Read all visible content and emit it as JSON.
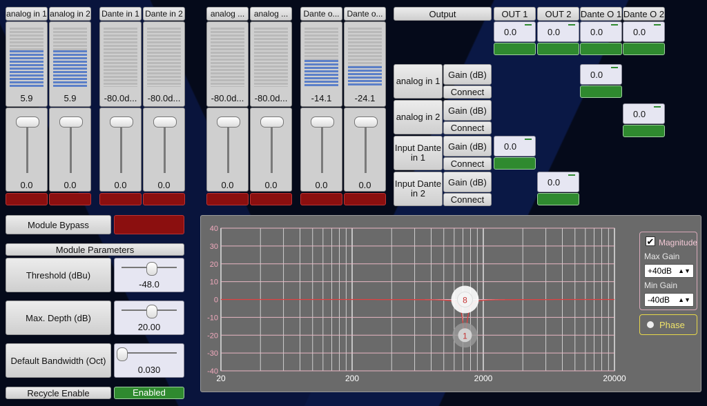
{
  "channels": [
    {
      "name": "analog in 1",
      "meter": "5.9",
      "fader": "0.0",
      "level": 0.62
    },
    {
      "name": "analog in 2",
      "meter": "5.9",
      "fader": "0.0",
      "level": 0.62
    },
    {
      "name": "Dante in 1",
      "meter": "-80.0d...",
      "fader": "0.0",
      "level": 0
    },
    {
      "name": "Dante in 2",
      "meter": "-80.0d...",
      "fader": "0.0",
      "level": 0
    },
    {
      "name": "analog ...",
      "meter": "-80.0d...",
      "fader": "0.0",
      "level": 0
    },
    {
      "name": "analog ...",
      "meter": "-80.0d...",
      "fader": "0.0",
      "level": 0
    },
    {
      "name": "Dante o...",
      "meter": "-14.1",
      "fader": "0.0",
      "level": 0.45
    },
    {
      "name": "Dante o...",
      "meter": "-24.1",
      "fader": "0.0",
      "level": 0.35
    }
  ],
  "matrix": {
    "output_label": "Output",
    "outputs": [
      {
        "name": "OUT 1",
        "gain": "0.0"
      },
      {
        "name": "OUT 2",
        "gain": "0.0"
      },
      {
        "name": "Dante O 1",
        "gain": "0.0"
      },
      {
        "name": "Dante O 2",
        "gain": "0.0"
      }
    ],
    "inputs": [
      {
        "name": "analog in 1",
        "gain_label": "Gain (dB)",
        "connect_label": "Connect",
        "cross_gain": "0.0"
      },
      {
        "name": "analog in 2",
        "gain_label": "Gain (dB)",
        "connect_label": "Connect",
        "cross_gain": "0.0"
      },
      {
        "name": "Input Dante in 1",
        "gain_label": "Gain (dB)",
        "connect_label": "Connect",
        "cross_gain": "0.0"
      },
      {
        "name": "Input Dante in 2",
        "gain_label": "Gain (dB)",
        "connect_label": "Connect",
        "cross_gain": "0.0"
      }
    ]
  },
  "module": {
    "bypass_label": "Module Bypass",
    "params_label": "Module Parameters",
    "threshold_label": "Threshold (dBu)",
    "threshold_value": "-48.0",
    "threshold_pos": 0.55,
    "depth_label": "Max. Depth (dB)",
    "depth_value": "20.00",
    "depth_pos": 0.55,
    "bandwidth_label": "Default Bandwidth (Oct)",
    "bandwidth_value": "0.030",
    "bandwidth_pos": 0.0,
    "recycle_label": "Recycle Enable",
    "recycle_value": "Enabled"
  },
  "eq": {
    "y_ticks": [
      "40",
      "30",
      "20",
      "10",
      "0",
      "-10",
      "-20",
      "-30",
      "-40"
    ],
    "x_ticks": [
      "20",
      "200",
      "2000",
      "20000"
    ],
    "handle_top": "8",
    "handle_bottom": "1",
    "magnitude_label": "Magnitude",
    "magnitude_checked": "✔",
    "max_gain_label": "Max Gain",
    "max_gain_value": "+40dB",
    "min_gain_label": "Min Gain",
    "min_gain_value": "-40dB",
    "phase_label": "Phase"
  }
}
